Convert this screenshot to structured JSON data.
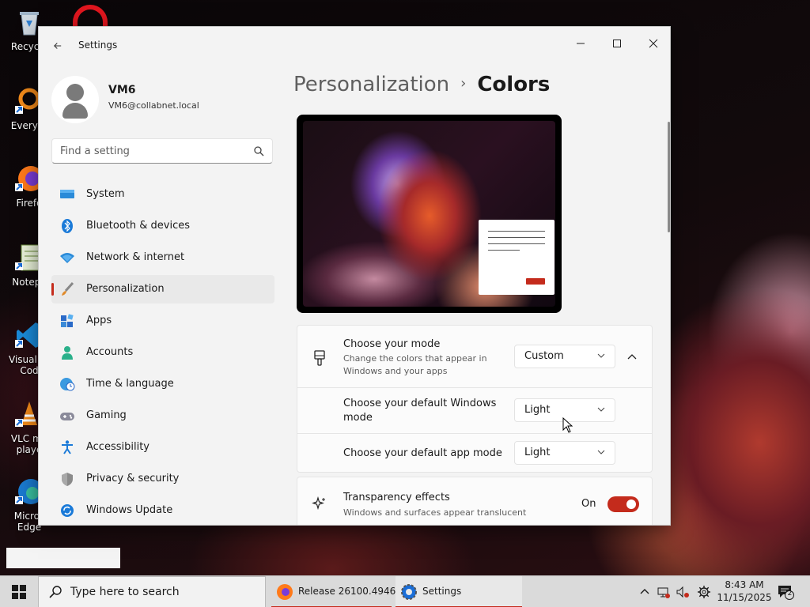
{
  "desktop": {
    "icons": [
      {
        "label": "Recycle"
      },
      {
        "label": "Everyth"
      },
      {
        "label": "Firefo"
      },
      {
        "label": "Notepa"
      },
      {
        "label": "Visual St Cod"
      },
      {
        "label": "VLC me playe"
      },
      {
        "label": "Micros Edge"
      }
    ]
  },
  "window": {
    "title": "Settings",
    "controls": {
      "minimize": "—",
      "maximize": "☐",
      "close": "✕"
    }
  },
  "profile": {
    "name": "VM6",
    "email": "VM6@collabnet.local"
  },
  "search": {
    "placeholder": "Find a setting"
  },
  "nav": {
    "items": [
      {
        "label": "System",
        "icon": "monitor-icon",
        "active": false
      },
      {
        "label": "Bluetooth & devices",
        "icon": "bluetooth-icon",
        "active": false
      },
      {
        "label": "Network & internet",
        "icon": "wifi-icon",
        "active": false
      },
      {
        "label": "Personalization",
        "icon": "paintbrush-icon",
        "active": true
      },
      {
        "label": "Apps",
        "icon": "apps-icon",
        "active": false
      },
      {
        "label": "Accounts",
        "icon": "person-icon",
        "active": false
      },
      {
        "label": "Time & language",
        "icon": "globe-clock-icon",
        "active": false
      },
      {
        "label": "Gaming",
        "icon": "gamepad-icon",
        "active": false
      },
      {
        "label": "Accessibility",
        "icon": "accessibility-icon",
        "active": false
      },
      {
        "label": "Privacy & security",
        "icon": "shield-icon",
        "active": false
      },
      {
        "label": "Windows Update",
        "icon": "update-icon",
        "active": false
      }
    ]
  },
  "breadcrumb": {
    "parent": "Personalization",
    "separator": "›",
    "current": "Colors"
  },
  "mode_card": {
    "title": "Choose your mode",
    "description": "Change the colors that appear in Windows and your apps",
    "value": "Custom",
    "expanded": true,
    "sub_rows": [
      {
        "title": "Choose your default Windows mode",
        "value": "Light"
      },
      {
        "title": "Choose your default app mode",
        "value": "Light"
      }
    ]
  },
  "transparency": {
    "title": "Transparency effects",
    "description": "Windows and surfaces appear translucent",
    "state_label": "On",
    "enabled": true
  },
  "taskbar": {
    "search_placeholder": "Type here to search",
    "apps": [
      {
        "label": "Release 26100.4946....",
        "icon": "firefox-icon"
      },
      {
        "label": "Settings",
        "icon": "settings-icon"
      }
    ],
    "clock": {
      "time": "8:43 AM",
      "date": "11/15/2025"
    },
    "notification_count": "2"
  },
  "colors": {
    "accent": "#c42b1c",
    "window_bg": "#f3f3f3",
    "card_bg": "#fbfbfb",
    "taskbar_bg": "#dadada"
  }
}
